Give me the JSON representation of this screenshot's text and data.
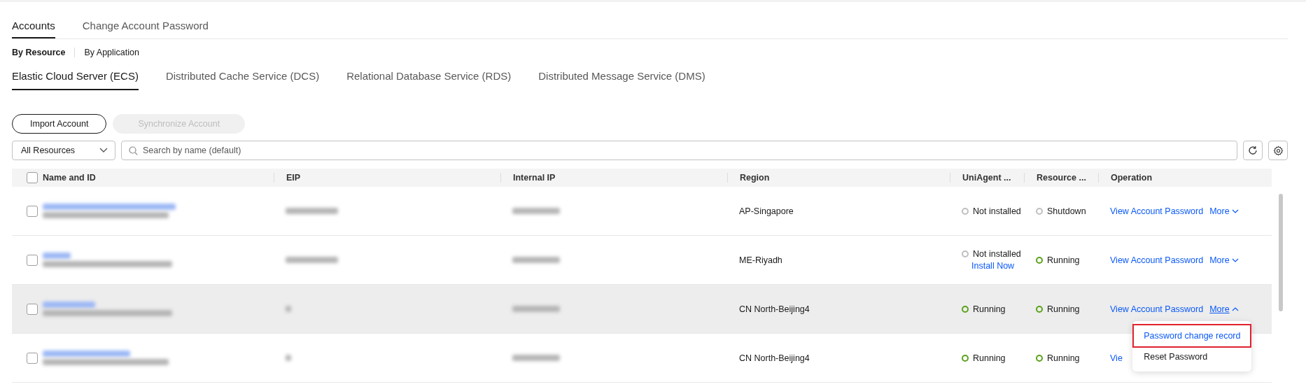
{
  "tabs": [
    {
      "label": "Accounts",
      "selected": true
    },
    {
      "label": "Change Account Password",
      "selected": false
    }
  ],
  "view_switch": [
    {
      "label": "By Resource",
      "selected": true
    },
    {
      "label": "By Application",
      "selected": false
    }
  ],
  "service_tabs": [
    {
      "label": "Elastic Cloud Server (ECS)",
      "selected": true
    },
    {
      "label": "Distributed Cache Service (DCS)",
      "selected": false
    },
    {
      "label": "Relational Database Service (RDS)",
      "selected": false
    },
    {
      "label": "Distributed Message Service (DMS)",
      "selected": false
    }
  ],
  "actions": [
    {
      "label": "Import Account",
      "disabled": false
    },
    {
      "label": "Synchronize Account",
      "disabled": true
    }
  ],
  "filter": {
    "scope": "All Resources",
    "placeholder": "Search by name (default)"
  },
  "table": {
    "select_all_checked": false,
    "columns": [
      "Name and ID",
      "EIP",
      "Internal IP",
      "Region",
      "UniAgent ...",
      "Resource ...",
      "Operation"
    ],
    "rows": [
      {
        "checked": false,
        "hovered": false,
        "region": "AP-Singapore",
        "uniagent": {
          "color": "#bfbfbf",
          "label": "Not installed"
        },
        "resource": {
          "color": "#bfbfbf",
          "label": "Shutdown"
        },
        "operation": "View Account Password",
        "more": "More",
        "expanded": false
      },
      {
        "checked": false,
        "hovered": false,
        "region": "ME-Riyadh",
        "uniagent": {
          "color": "#bfbfbf",
          "label": "Not installed",
          "action": "Install Now"
        },
        "resource": {
          "color": "#5aa21a",
          "label": "Running"
        },
        "operation": "View Account Password",
        "more": "More",
        "expanded": false
      },
      {
        "checked": false,
        "hovered": true,
        "region": "CN North-Beijing4",
        "uniagent": {
          "color": "#5aa21a",
          "label": "Running"
        },
        "resource": {
          "color": "#5aa21a",
          "label": "Running"
        },
        "operation": "View Account Password",
        "more": "More",
        "expanded": true
      },
      {
        "checked": false,
        "hovered": false,
        "region": "CN North-Beijing4",
        "uniagent": {
          "color": "#5aa21a",
          "label": "Running"
        },
        "resource": {
          "color": "#5aa21a",
          "label": "Running"
        },
        "operation": "Vie"
      }
    ]
  },
  "menu": [
    {
      "label": "Password change record",
      "highlighted": true
    },
    {
      "label": "Reset Password",
      "highlighted": false
    }
  ]
}
